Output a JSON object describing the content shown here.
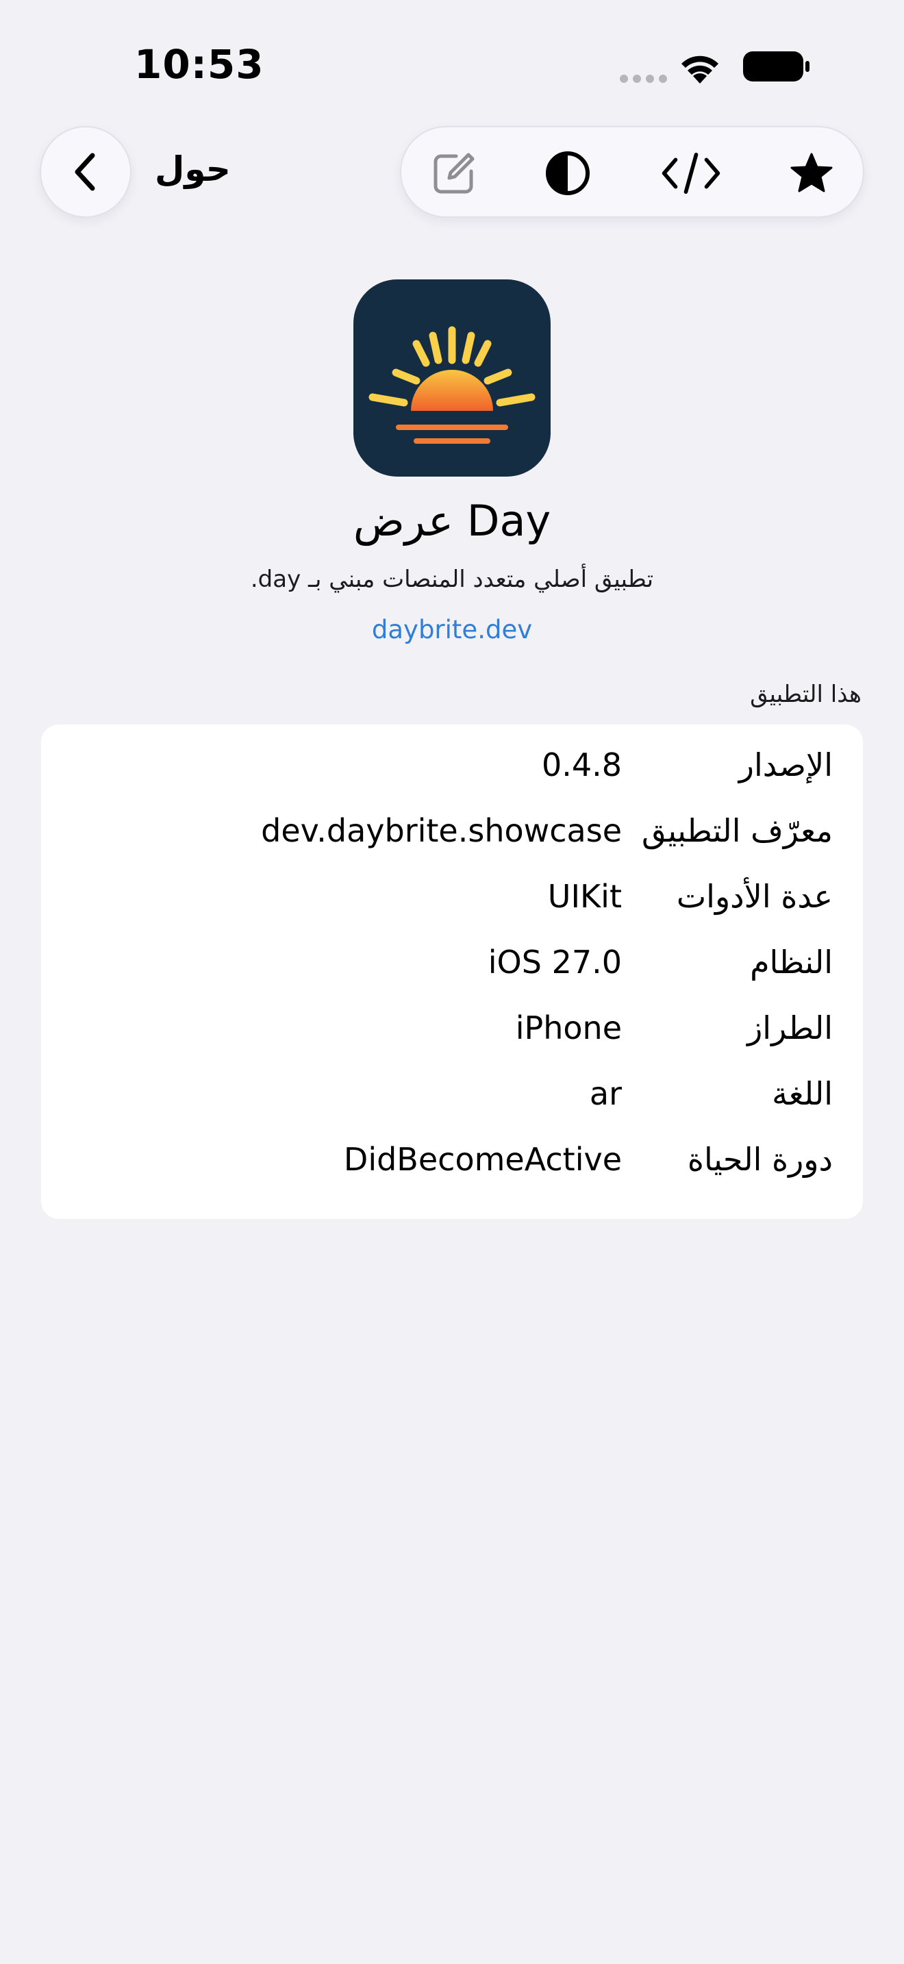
{
  "status_bar": {
    "time": "10:53"
  },
  "nav": {
    "title": "حول",
    "back_icon": "chevron-left-icon",
    "toolbar_icons": [
      "compose-icon",
      "contrast-icon",
      "code-icon",
      "star-icon"
    ]
  },
  "app": {
    "name": "عرض Day",
    "tagline": "تطبيق أصلي متعدد المنصات مبني بـ day.",
    "link": "daybrite.dev",
    "icon_background": "#142d42",
    "link_color": "#2f7fd6"
  },
  "section": {
    "header": "هذا التطبيق",
    "rows": [
      {
        "label": "الإصدار",
        "value": "0.4.8"
      },
      {
        "label": "معرّف التطبيق",
        "value": "dev.daybrite.showcase"
      },
      {
        "label": "عدة الأدوات",
        "value": "UIKit"
      },
      {
        "label": "النظام",
        "value": "iOS 27.0"
      },
      {
        "label": "الطراز",
        "value": "iPhone"
      },
      {
        "label": "اللغة",
        "value": "ar"
      },
      {
        "label": "دورة الحياة",
        "value": "DidBecomeActive"
      }
    ]
  }
}
